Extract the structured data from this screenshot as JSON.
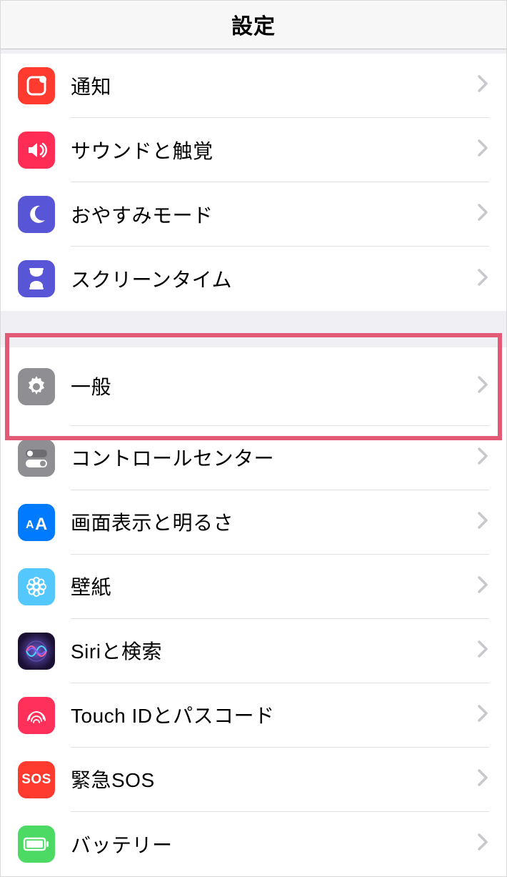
{
  "header": {
    "title": "設定"
  },
  "groups": [
    {
      "rows": [
        {
          "id": "notifications",
          "label": "通知",
          "icon": "notification-icon",
          "bg": "bg-red"
        },
        {
          "id": "sounds",
          "label": "サウンドと触覚",
          "icon": "sound-icon",
          "bg": "bg-pink"
        },
        {
          "id": "dnd",
          "label": "おやすみモード",
          "icon": "moon-icon",
          "bg": "bg-indigo"
        },
        {
          "id": "screentime",
          "label": "スクリーンタイム",
          "icon": "hourglass-icon",
          "bg": "bg-indigo"
        }
      ]
    },
    {
      "rows": [
        {
          "id": "general",
          "label": "一般",
          "icon": "gear-icon",
          "bg": "bg-gray",
          "highlight": true
        },
        {
          "id": "control-center",
          "label": "コントロールセンター",
          "icon": "toggle-icon",
          "bg": "bg-gray"
        },
        {
          "id": "display",
          "label": "画面表示と明るさ",
          "icon": "text-size-icon",
          "bg": "bg-blue"
        },
        {
          "id": "wallpaper",
          "label": "壁紙",
          "icon": "flower-icon",
          "bg": "bg-cyan"
        },
        {
          "id": "siri",
          "label": "Siriと検索",
          "icon": "siri-icon",
          "bg": "bg-siri"
        },
        {
          "id": "touchid",
          "label": "Touch IDとパスコード",
          "icon": "fingerprint-icon",
          "bg": "bg-touch"
        },
        {
          "id": "sos",
          "label": "緊急SOS",
          "icon": "sos-icon",
          "bg": "bg-sos",
          "iconText": "SOS"
        },
        {
          "id": "battery",
          "label": "バッテリー",
          "icon": "battery-icon",
          "bg": "bg-green"
        }
      ]
    }
  ],
  "colors": {
    "highlight_border": "#e35a76",
    "separator": "#e0e0e2",
    "chevron": "#c7c7cc"
  }
}
